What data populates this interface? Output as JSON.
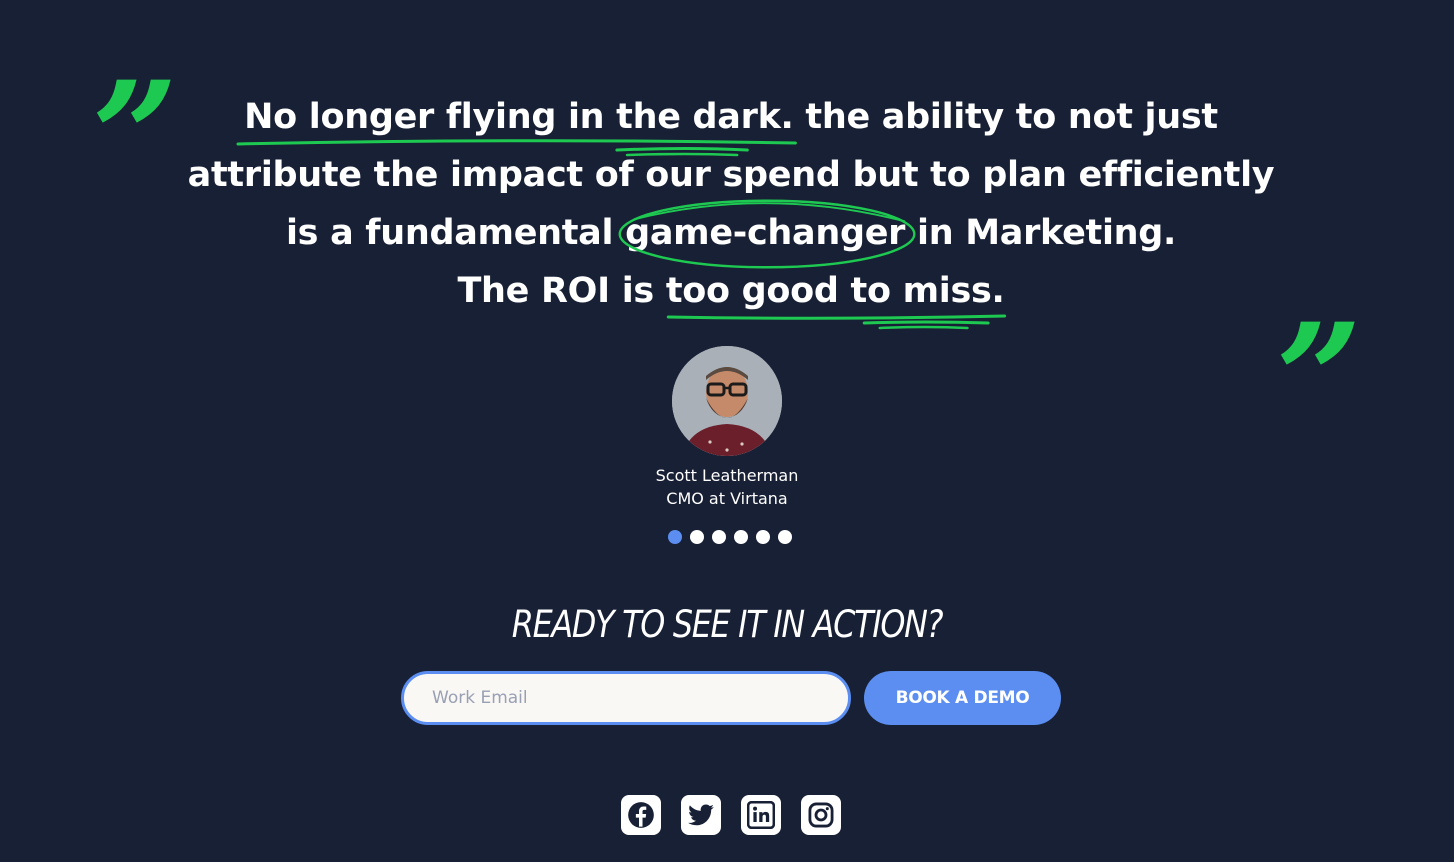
{
  "testimonial": {
    "quote_lines": {
      "l1_highlight": "No longer flying in the dark.",
      "l1_rest": " the ability to not just",
      "l2": "attribute the impact of our spend but to plan efficiently",
      "l3_before": "is a fundamental ",
      "l3_highlight": "game-changer",
      "l3_after": " in Marketing.",
      "l4_before": "The ROI is ",
      "l4_highlight": "too good to miss."
    },
    "author_name": "Scott Leatherman",
    "author_title": "CMO at Virtana",
    "carousel": {
      "total": 6,
      "active_index": 0
    }
  },
  "cta": {
    "heading": "READY TO SEE IT IN ACTION?",
    "email_placeholder": "Work Email",
    "email_value": "",
    "button_label": "BOOK A DEMO"
  },
  "social": [
    {
      "icon": "facebook-icon"
    },
    {
      "icon": "twitter-icon"
    },
    {
      "icon": "linkedin-icon"
    },
    {
      "icon": "instagram-icon"
    }
  ],
  "colors": {
    "background": "#182035",
    "accent_green": "#1ec951",
    "accent_blue": "#5b8ef0",
    "text": "#ffffff"
  },
  "quote_marks": {
    "open": "”",
    "close": "”"
  }
}
